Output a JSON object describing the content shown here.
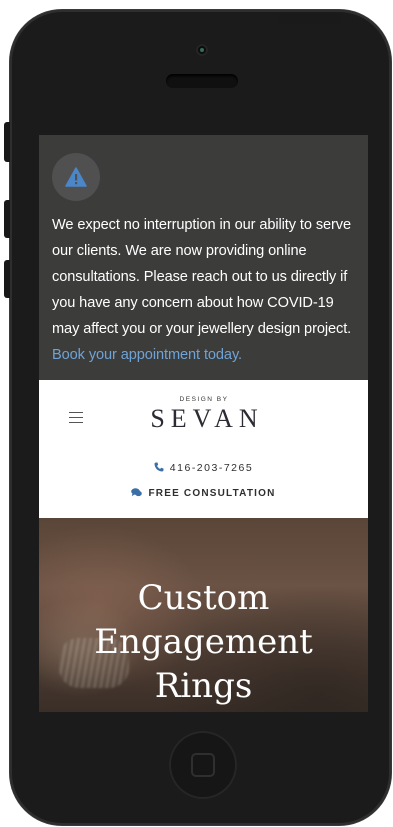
{
  "alert": {
    "icon": "warning-triangle-icon",
    "text": "We expect no interruption in our ability to serve our clients. We are now providing online consultations. Please reach out to us directly if you have any concern about how COVID-19 may affect you or your jewellery design project.",
    "link_text": "Book your appointment today.",
    "link_color": "#6fa3d6",
    "background": "#3c3c3b"
  },
  "header": {
    "logo_small": "DESIGN BY",
    "logo_main": "SEVAN",
    "phone": "416-203-7265",
    "consultation": "FREE CONSULTATION",
    "accent": "#3a6fa8"
  },
  "hero": {
    "title_line1": "Custom",
    "title_line2": "Engagement",
    "title_line3": "Rings"
  }
}
